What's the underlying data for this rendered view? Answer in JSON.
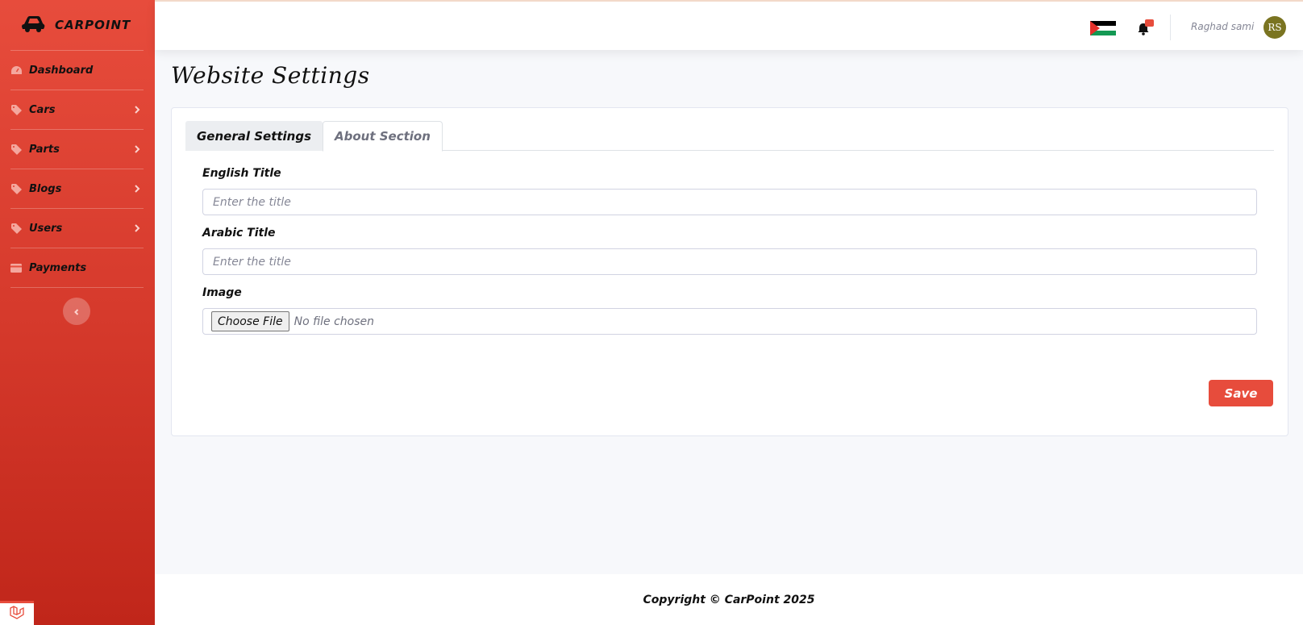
{
  "brand": {
    "name": "CARPOINT",
    "icon": "car-icon"
  },
  "sidebar": {
    "items": [
      {
        "label": "Dashboard",
        "icon": "tachometer-icon",
        "has_submenu": false
      },
      {
        "label": "Cars",
        "icon": "tag-icon",
        "has_submenu": true
      },
      {
        "label": "Parts",
        "icon": "tag-icon",
        "has_submenu": true
      },
      {
        "label": "Blogs",
        "icon": "tag-icon",
        "has_submenu": true
      },
      {
        "label": "Users",
        "icon": "tag-icon",
        "has_submenu": true
      },
      {
        "label": "Payments",
        "icon": "credit-card-icon",
        "has_submenu": false
      }
    ],
    "collapse_icon": "chevron-left-icon"
  },
  "topbar": {
    "flag_icon": "palestine-flag-icon",
    "notification_icon": "bell-icon",
    "user_name": "Raghad sami",
    "avatar_initials": "RS"
  },
  "page": {
    "title": "Website Settings",
    "tabs": [
      {
        "label": "General Settings",
        "active": false
      },
      {
        "label": "About Section",
        "active": true
      }
    ],
    "form": {
      "english_title_label": "English Title",
      "english_title_placeholder": "Enter the title",
      "english_title_value": "",
      "arabic_title_label": "Arabic Title",
      "arabic_title_placeholder": "Enter the title",
      "arabic_title_value": "",
      "image_label": "Image",
      "file_button_label": "Choose File",
      "file_status": "No file chosen"
    },
    "save_label": "Save"
  },
  "footer": {
    "text": "Copyright © CarPoint 2025"
  },
  "colors": {
    "accent": "#e74c3c",
    "avatar_bg": "#7a7421"
  }
}
